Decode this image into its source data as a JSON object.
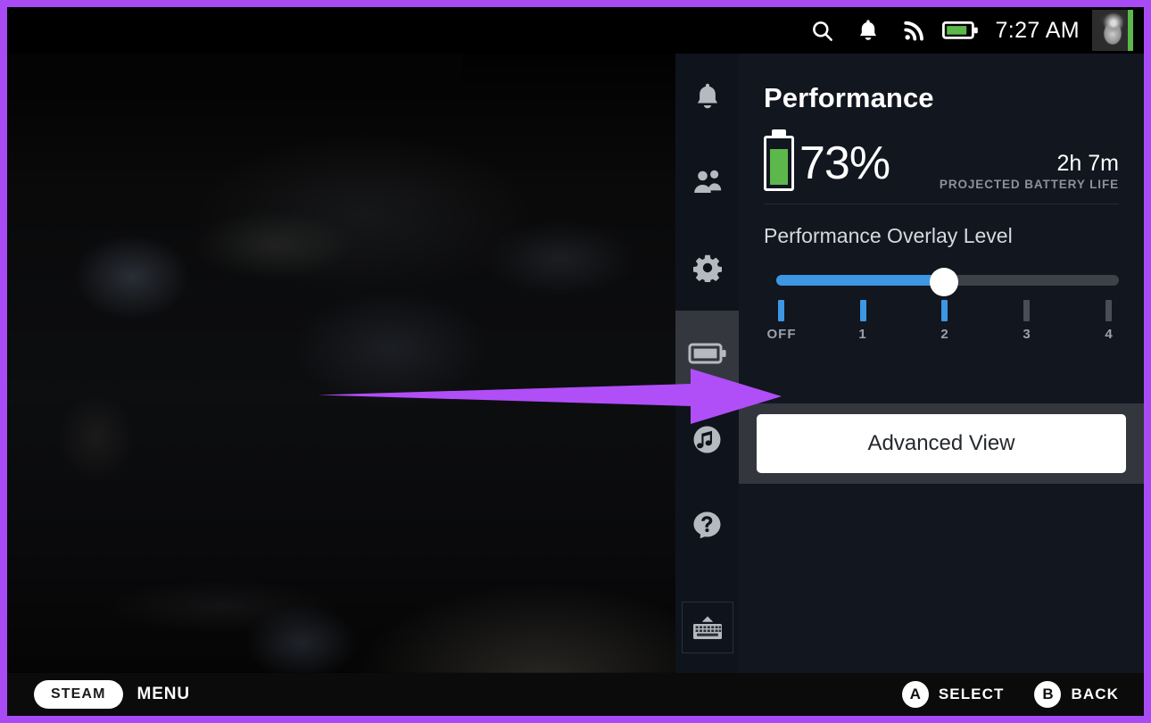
{
  "theme": {
    "border_color": "#a84bf5",
    "panel_bg": "#12161f",
    "accent_blue": "#3d97e3",
    "battery_green": "#5cb84a",
    "highlight_row": "#33363d",
    "arrow_color": "#b04ef7"
  },
  "statusbar": {
    "icons": [
      {
        "name": "search-icon"
      },
      {
        "name": "notifications-bell-icon"
      },
      {
        "name": "wifi-icon"
      },
      {
        "name": "battery-icon"
      }
    ],
    "clock": "7:27 AM",
    "avatar_name": "user-avatar",
    "avatar_status": "online"
  },
  "sidebar": {
    "items": [
      {
        "name": "sidebar-item-notifications",
        "icon": "bell-icon",
        "active": false
      },
      {
        "name": "sidebar-item-friends",
        "icon": "friends-icon",
        "active": false
      },
      {
        "name": "sidebar-item-settings",
        "icon": "gear-icon",
        "active": false
      },
      {
        "name": "sidebar-item-performance",
        "icon": "battery-performance-icon",
        "active": true
      },
      {
        "name": "sidebar-item-music",
        "icon": "music-note-icon",
        "active": false
      },
      {
        "name": "sidebar-item-help",
        "icon": "help-question-icon",
        "active": false
      }
    ],
    "keyboard_item": {
      "name": "sidebar-item-keyboard",
      "icon": "keyboard-icon"
    }
  },
  "panel": {
    "title": "Performance",
    "battery": {
      "percent": "73%",
      "fill_ratio": 0.73,
      "projected_time": "2h 7m",
      "projected_label": "PROJECTED BATTERY LIFE"
    },
    "slider": {
      "label": "Performance Overlay Level",
      "value": 2,
      "min": 0,
      "max": 4,
      "ticks": [
        {
          "label": "OFF",
          "active": true
        },
        {
          "label": "1",
          "active": true
        },
        {
          "label": "2",
          "active": true
        },
        {
          "label": "3",
          "active": false
        },
        {
          "label": "4",
          "active": false
        }
      ]
    },
    "advanced_view_button": "Advanced View"
  },
  "annotation": {
    "arrow_name": "callout-arrow",
    "points_to": "Advanced View"
  },
  "bottombar": {
    "steam_label": "STEAM",
    "menu_label": "MENU",
    "hints": [
      {
        "badge": "A",
        "text": "SELECT"
      },
      {
        "badge": "B",
        "text": "BACK"
      }
    ]
  }
}
